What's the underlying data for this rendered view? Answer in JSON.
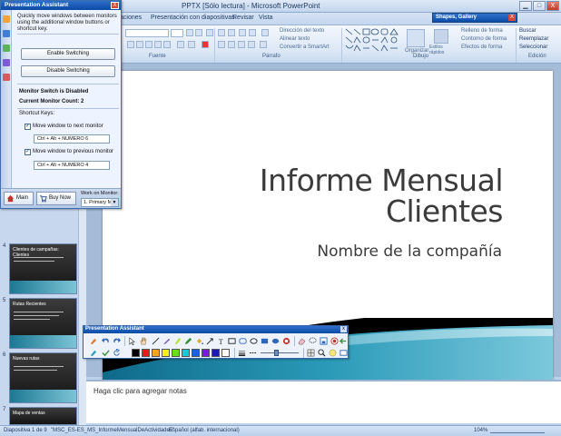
{
  "window": {
    "title": "PPTX [Sólo lectura] - Microsoft PowerPoint",
    "min": "▁",
    "max": "□",
    "close": "X"
  },
  "tabs": [
    "aciones",
    "Presentación con diapositivas",
    "Revisar",
    "Vista"
  ],
  "ribbon": {
    "groups": [
      "Fuente",
      "Párrafo",
      "Dibujo",
      "Edición"
    ],
    "paragraph_items": [
      "Dirección del texto",
      "Alinear texto",
      "Convertir a SmartArt"
    ],
    "drawing_items": [
      "Relleno de forma",
      "Contorno de forma",
      "Efectos de forma"
    ],
    "drawing_buttons": [
      "Organizar",
      "Estilos rápidos"
    ],
    "editing_items": [
      "Buscar",
      "Reemplazar",
      "Seleccionar"
    ]
  },
  "shapes_gallery": {
    "label": "Shapes, Gallery",
    "close": "X"
  },
  "slide": {
    "title_line1": "Informe Mensual",
    "title_line2": "Clientes",
    "subtitle": "Nombre de la compañía"
  },
  "notes_placeholder": "Haga clic para agregar notas",
  "thumbnails": [
    {
      "num": "4",
      "label": "Clientes de campañas: Clientes"
    },
    {
      "num": "5",
      "label": "Rutas Recientes"
    },
    {
      "num": "6",
      "label": "Nuevas rutas"
    },
    {
      "num": "7",
      "label": "Mapa de ventas"
    }
  ],
  "status": {
    "slide": "Diapositiva 1 de 9",
    "theme": "\"MSC_ES-ES_MS_InformeMensualDeActividades\"",
    "language": "Español (alfab. internacional)",
    "zoom": "104%"
  },
  "assistant": {
    "title": "Presentation Assistant",
    "close": "X",
    "description": "Quickly move windows between monitors using the additional window buttons or shortcut key.",
    "enable_button": "Enable Switching",
    "disable_button": "Disable Switching",
    "status_disabled": "Monitor Switch is Disabled",
    "monitor_count": "Current Monitor Count: 2",
    "shortcut_label": "Shortcut Keys:",
    "next_label": "Move window to next monitor",
    "next_value": "Ctrl + Alt + NUMERO 6",
    "prev_label": "Move window to previous monitor",
    "prev_value": "Ctrl + Alt + NUMERO 4",
    "main_button": "Main",
    "buynow_button": "Buy Now",
    "work_on_label": "Work on Monitor:",
    "monitor_selected": "1. Primary M",
    "check": "✓"
  },
  "toolbar": {
    "title": "Presentation Assistant",
    "close": "x",
    "colors": [
      "#000000",
      "#e31b1b",
      "#f7a21b",
      "#f7ee1b",
      "#6fdc1b",
      "#1bc8d8",
      "#1b5fe3",
      "#7a1be3",
      "#1b1bb0",
      "#ffffff"
    ]
  }
}
